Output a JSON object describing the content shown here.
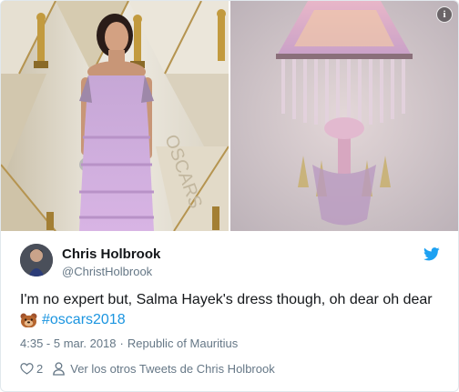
{
  "media": {
    "left_photo_icon": "photo-red-carpet",
    "right_photo_icon": "photo-chandelier",
    "info_icon": "info-icon",
    "info_glyph": "i"
  },
  "author": {
    "display_name": "Chris Holbrook",
    "handle": "@ChristHolbrook",
    "avatar_icon": "avatar"
  },
  "tweet": {
    "text_line1": "I'm no expert but, Salma Hayek's dress though, oh dear oh dear",
    "emoji_icon": "bear-face-icon",
    "hashtag": "#oscars2018",
    "time": "4:35 - 5 mar. 2018",
    "separator": "·",
    "location": "Republic of Mauritius"
  },
  "footer": {
    "like_count": "2",
    "more_tweets": "Ver los otros Tweets de Chris Holbrook"
  },
  "colors": {
    "link": "#1b95e0",
    "muted": "#657786",
    "text": "#14171a",
    "border": "#e1e8ed",
    "twitter_blue": "#1da1f2"
  }
}
